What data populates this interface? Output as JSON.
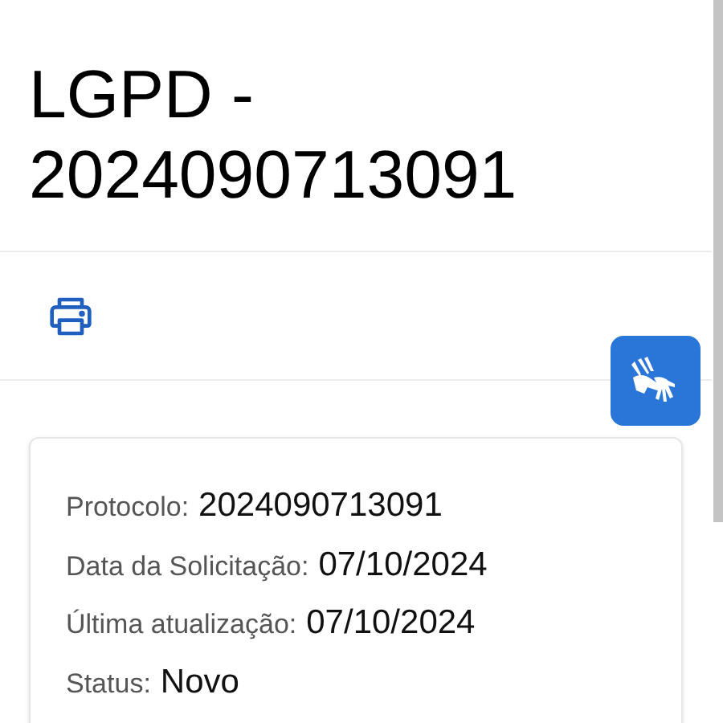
{
  "title_lines": [
    "LGPD -",
    "2024090713091"
  ],
  "details": [
    {
      "label": "Protocolo:",
      "value": "2024090713091"
    },
    {
      "label": "Data da Solicitação:",
      "value": "07/10/2024"
    },
    {
      "label": "Última atualização:",
      "value": "07/10/2024"
    },
    {
      "label": "Status:",
      "value": "Novo"
    }
  ]
}
